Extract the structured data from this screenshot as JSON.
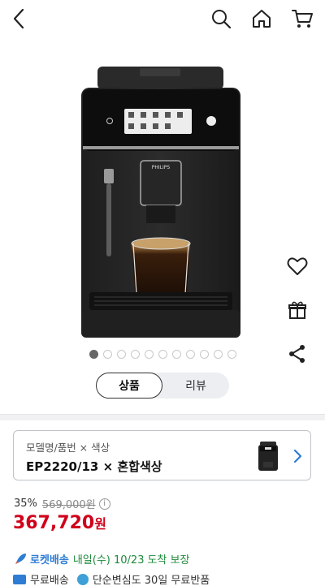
{
  "header": {
    "back_icon": "chevron-left-icon",
    "search_icon": "search-icon",
    "home_icon": "home-icon",
    "cart_icon": "cart-icon"
  },
  "product_image": {
    "icon": "coffee-machine-image",
    "brand_text": "PHILIPS"
  },
  "side_actions": [
    {
      "icon": "heart-icon"
    },
    {
      "icon": "gift-icon"
    },
    {
      "icon": "share-icon"
    }
  ],
  "carousel": {
    "total": 11,
    "active_index": 0
  },
  "tabs": {
    "selected": "상품",
    "other": "리뷰"
  },
  "option": {
    "label": "모델명/품번 × 색상",
    "value": "EP2220/13 × 혼합색상"
  },
  "price": {
    "discount": "35%",
    "original": "569,000원",
    "info_symbol": "i",
    "final": "367,720",
    "unit": "원"
  },
  "delivery": {
    "rocket_label": "로켓배송",
    "date": "내일(수) 10/23",
    "rest": "도착 보장"
  },
  "shipping": {
    "free_shipping": "무료배송",
    "free_return": "단순변심도 30일 무료반품"
  },
  "colors": {
    "price_red": "#d0021b",
    "rocket_blue": "#2e7cd4",
    "delivery_green": "#1d8a3a"
  }
}
